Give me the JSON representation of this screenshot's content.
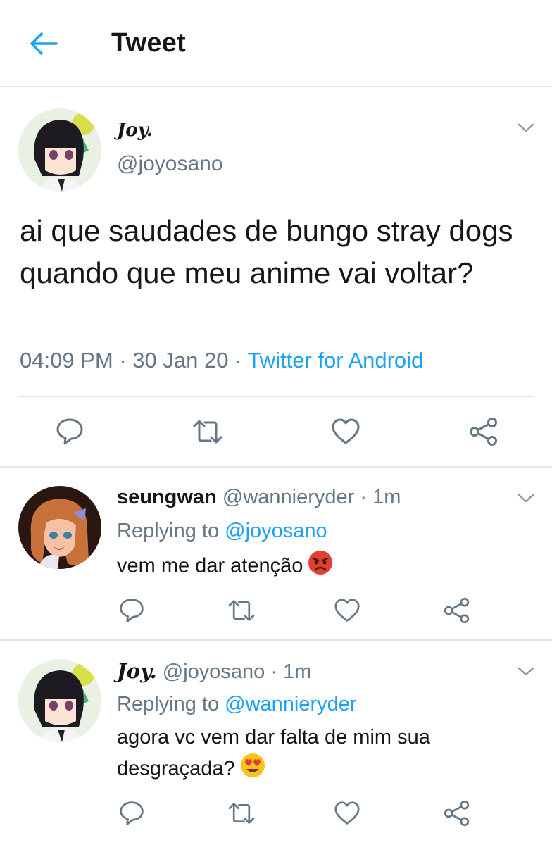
{
  "header": {
    "title": "Tweet",
    "back_icon": "arrow-left-icon"
  },
  "colors": {
    "accent": "#1da1f2",
    "secondary_text": "#657786",
    "primary_text": "#14171a",
    "divider": "#e1e8ed"
  },
  "main_tweet": {
    "display_name": "Joy.",
    "handle": "@joyosano",
    "text": "ai que saudades de bungo stray dogs quando que meu anime vai voltar?",
    "time": "04:09 PM",
    "date": "30 Jan 20",
    "separator": "·",
    "source": "Twitter for Android"
  },
  "replies": [
    {
      "display_name": "seungwan",
      "handle": "@wannieryder",
      "separator": "·",
      "time_ago": "1m",
      "replying_prefix": "Replying to",
      "replying_to": "@joyosano",
      "text": "vem me dar atenção",
      "emoji": "angry-face-emoji"
    },
    {
      "display_name": "Joy.",
      "handle": "@joyosano",
      "separator": "·",
      "time_ago": "1m",
      "replying_prefix": "Replying to",
      "replying_to": "@wannieryder",
      "text": "agora vc vem dar falta de mim sua desgraçada?",
      "emoji": "heart-eyes-emoji"
    }
  ]
}
